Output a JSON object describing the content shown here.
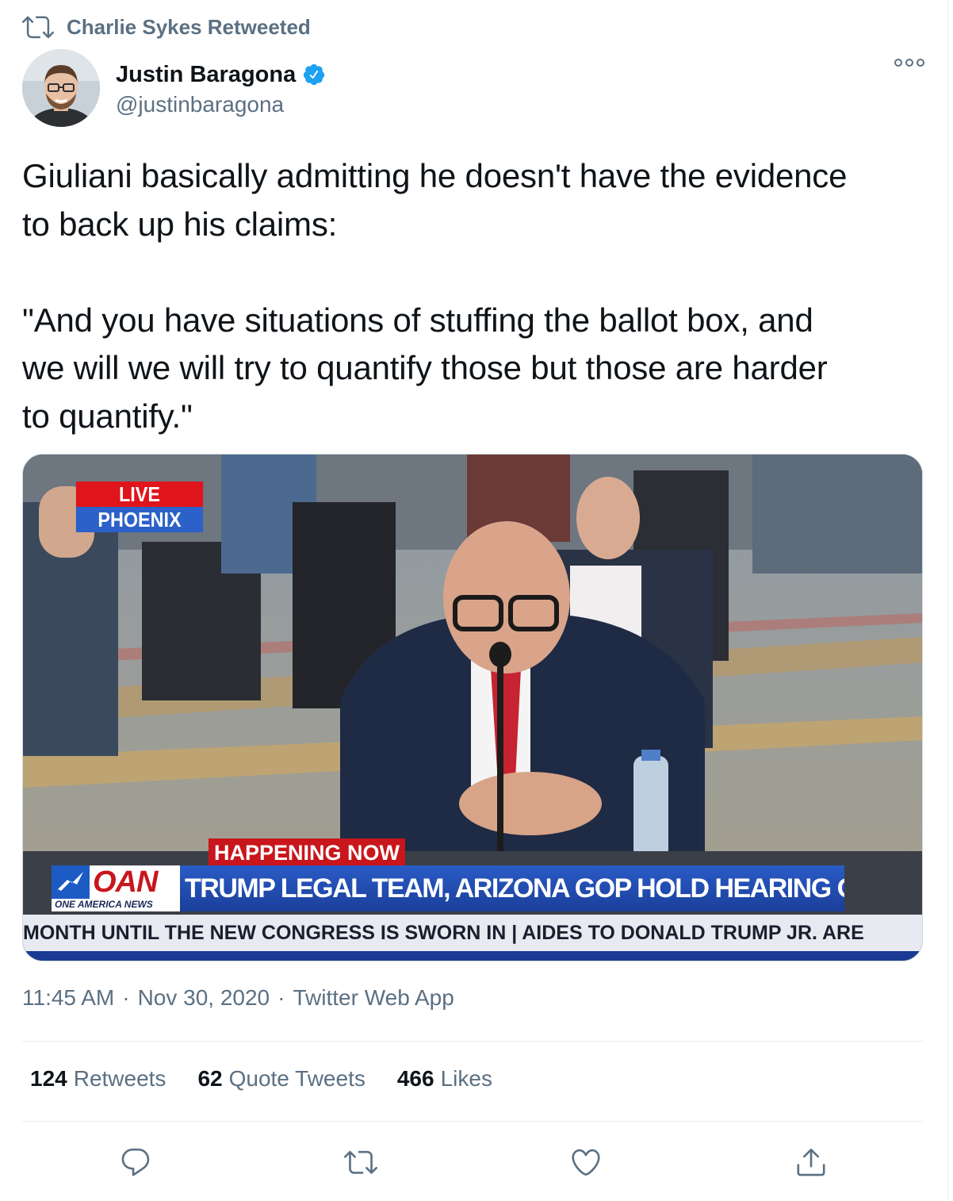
{
  "retweet_context": {
    "icon": "retweet-icon",
    "text": "Charlie Sykes Retweeted"
  },
  "author": {
    "display_name": "Justin Baragona",
    "handle": "@justinbaragona",
    "verified_icon": "verified-badge-icon",
    "more_icon": "more-options-icon"
  },
  "tweet": {
    "text": "Giuliani basically admitting he doesn't have the evidence\nto back up his claims:\n\n\"And you have situations of stuffing the ballot box, and\nwe will we will try to quantify those but those are harder\nto quantify.\""
  },
  "media": {
    "live_label": "LIVE",
    "location_label": "PHOENIX",
    "happening_label": "HAPPENING NOW",
    "network_logo": "OAN",
    "network_name": "ONE AMERICA NEWS",
    "headline": "TRUMP LEGAL TEAM, ARIZONA GOP HOLD HEARING ON ELECTION FRAUD",
    "ticker": "MONTH UNTIL THE NEW CONGRESS IS SWORN IN  |  AIDES TO DONALD TRUMP JR. ARE",
    "colors": {
      "live_red": "#e0141b",
      "oan_blue": "#2a5bc6"
    }
  },
  "meta": {
    "time": "11:45 AM",
    "date": "Nov 30, 2020",
    "source": "Twitter Web App",
    "separator": "·"
  },
  "stats": {
    "retweets_count": "124",
    "retweets_label": "Retweets",
    "quotes_count": "62",
    "quotes_label": "Quote Tweets",
    "likes_count": "466",
    "likes_label": "Likes"
  },
  "actions": [
    "reply-icon",
    "retweet-icon",
    "like-icon",
    "share-icon"
  ],
  "theme": {
    "text": "#0f1419",
    "secondary": "#5b7083",
    "verified": "#1da1f2"
  }
}
